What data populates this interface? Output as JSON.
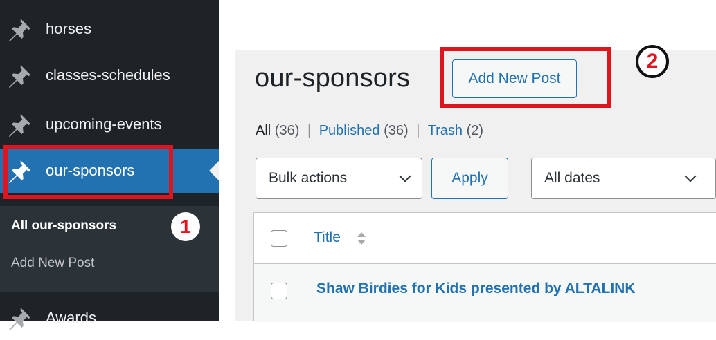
{
  "sidebar": {
    "items": [
      {
        "label": "horses",
        "icon": "pin-icon"
      },
      {
        "label": "classes-schedules",
        "icon": "pin-icon"
      },
      {
        "label": "upcoming-events",
        "icon": "pin-icon"
      },
      {
        "label": "our-sponsors",
        "icon": "pin-icon",
        "active": true
      },
      {
        "label": "Awards",
        "icon": "pin-icon"
      }
    ],
    "submenu": [
      {
        "label": "All our-sponsors",
        "current": true
      },
      {
        "label": "Add New Post"
      }
    ]
  },
  "main": {
    "title": "our-sponsors",
    "add_new_label": "Add New Post",
    "filters": {
      "all": "All",
      "all_count": "(36)",
      "published": "Published",
      "published_count": "(36)",
      "trash": "Trash",
      "trash_count": "(2)",
      "sep": "|"
    },
    "bulk_actions": "Bulk actions",
    "apply": "Apply",
    "all_dates": "All dates",
    "table": {
      "column_title": "Title",
      "rows": [
        {
          "title": "Shaw Birdies for Kids presented by ALTALINK"
        }
      ]
    }
  },
  "annotations": {
    "step1": "1",
    "step2": "2",
    "highlight_color": "#e0141e"
  },
  "colors": {
    "sidebar_bg": "#1d2327",
    "active_bg": "#2271b1",
    "link": "#2271b1"
  }
}
